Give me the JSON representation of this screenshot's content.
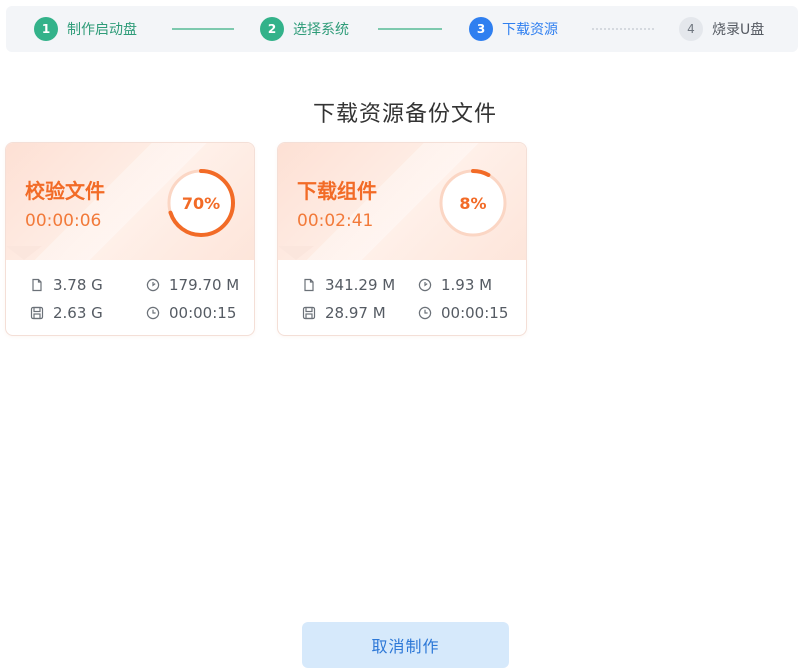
{
  "steps": [
    {
      "num": "1",
      "label": "制作启动盘",
      "state": "done"
    },
    {
      "num": "2",
      "label": "选择系统",
      "state": "done"
    },
    {
      "num": "3",
      "label": "下载资源",
      "state": "active"
    },
    {
      "num": "4",
      "label": "烧录U盘",
      "state": "pending"
    }
  ],
  "page_title": "下载资源备份文件",
  "cards": [
    {
      "name": "校验文件",
      "elapsed": "00:00:06",
      "progress_label": "70%",
      "progress": 0.7,
      "total_size": "3.78 G",
      "done_size": "2.63 G",
      "speed": "179.70 M",
      "remaining": "00:00:15"
    },
    {
      "name": "下载组件",
      "elapsed": "00:02:41",
      "progress_label": "8%",
      "progress": 0.08,
      "total_size": "341.29 M",
      "done_size": "28.97 M",
      "speed": "1.93 M",
      "remaining": "00:00:15"
    }
  ],
  "cancel_label": "取消制作",
  "colors": {
    "accent_orange": "#f26b27",
    "step_done": "#33b28a",
    "step_active": "#2f7ff0",
    "button_bg": "#d6e9fb",
    "button_text": "#2d78d7"
  },
  "icons": {
    "total_size": "file-icon",
    "done_size": "save-icon",
    "speed": "speed-icon",
    "remaining": "clock-icon"
  }
}
